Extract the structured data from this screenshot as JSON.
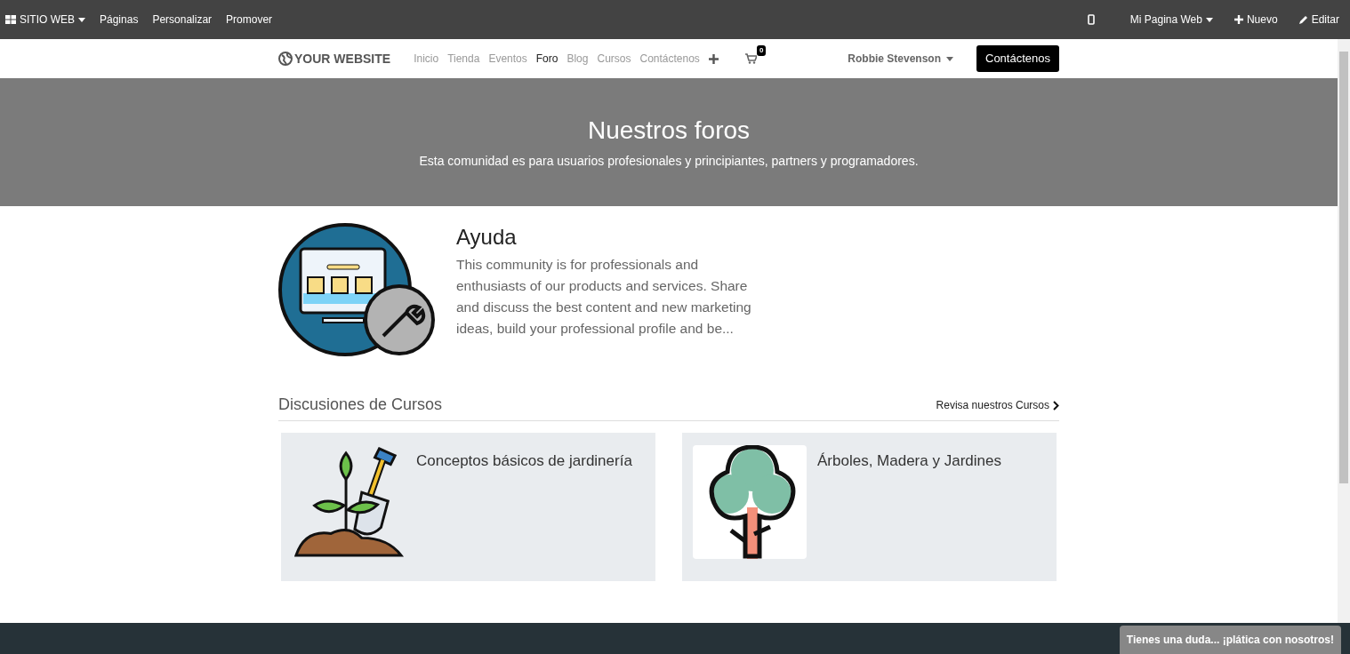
{
  "admin_bar": {
    "menu": "SITIO WEB",
    "items": [
      "Páginas",
      "Personalizar",
      "Promover"
    ],
    "website": "Mi Pagina Web",
    "new": "Nuevo",
    "edit": "Editar"
  },
  "navbar": {
    "logo": "YOUR WEBSITE",
    "links": [
      {
        "label": "Inicio",
        "selected": false
      },
      {
        "label": "Tienda",
        "selected": false
      },
      {
        "label": "Eventos",
        "selected": false
      },
      {
        "label": "Foro",
        "selected": true
      },
      {
        "label": "Blog",
        "selected": false
      },
      {
        "label": "Cursos",
        "selected": false
      },
      {
        "label": "Contáctenos",
        "selected": false
      }
    ],
    "cart_count": "0",
    "user": "Robbie Stevenson",
    "cta": "Contáctenos"
  },
  "hero": {
    "title": "Nuestros foros",
    "subtitle": "Esta comunidad es para usuarios profesionales y principiantes, partners y programadores."
  },
  "forum": {
    "title": "Ayuda",
    "description": "This community is for professionals and enthusiasts of our products and services. Share and discuss the best content and new marketing ideas, build your professional profile and be..."
  },
  "courses": {
    "title": "Discusiones de Cursos",
    "link": "Revisa nuestros Cursos",
    "items": [
      {
        "kind": "plant",
        "title": "Conceptos básicos de jardinería"
      },
      {
        "kind": "tree",
        "title": "Árboles, Madera y Jardines"
      }
    ]
  },
  "chat": {
    "label": "Tienes una duda... ¡plática con nosotros!"
  }
}
